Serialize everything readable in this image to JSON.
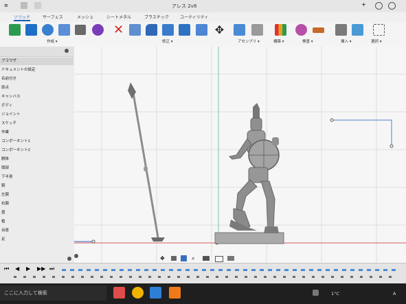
{
  "app": {
    "title": "アレス 2v8",
    "tabs": [
      "ソリッド",
      "サーフェス",
      "メッシュ",
      "シートメタル",
      "プラスチック",
      "ユーティリティ"
    ],
    "active_tab": "ソリッド"
  },
  "toolbar": {
    "groups": [
      "作成 ▾",
      "修正 ▾",
      "アセンブリ ▾",
      "構築 ▾",
      "検査 ▾",
      "挿入 ▾",
      "選択 ▾"
    ]
  },
  "browser": {
    "items": [
      "ブラウザ",
      "ドキュメントの設定",
      "名前付き",
      "原点",
      "キャンバス",
      "ボディ",
      "ジョイント",
      "スケッチ",
      "作業",
      "コンポーネント1",
      "コンポーネント2",
      "胴体",
      "頭部",
      "下半身",
      "腕",
      "左腕",
      "右腕",
      "盾",
      "槍",
      "台座",
      "足"
    ]
  },
  "timeline": {
    "controls": [
      "⏮",
      "◀",
      "▶",
      "▶▶",
      "⏭"
    ]
  },
  "taskbar": {
    "search_placeholder": "ここに入力して検索",
    "temperature": "1°C",
    "language": "A"
  },
  "colors": {
    "accent": "#1b5fb4",
    "model": "#8f8f8f",
    "grid": "#dcdcdc"
  }
}
